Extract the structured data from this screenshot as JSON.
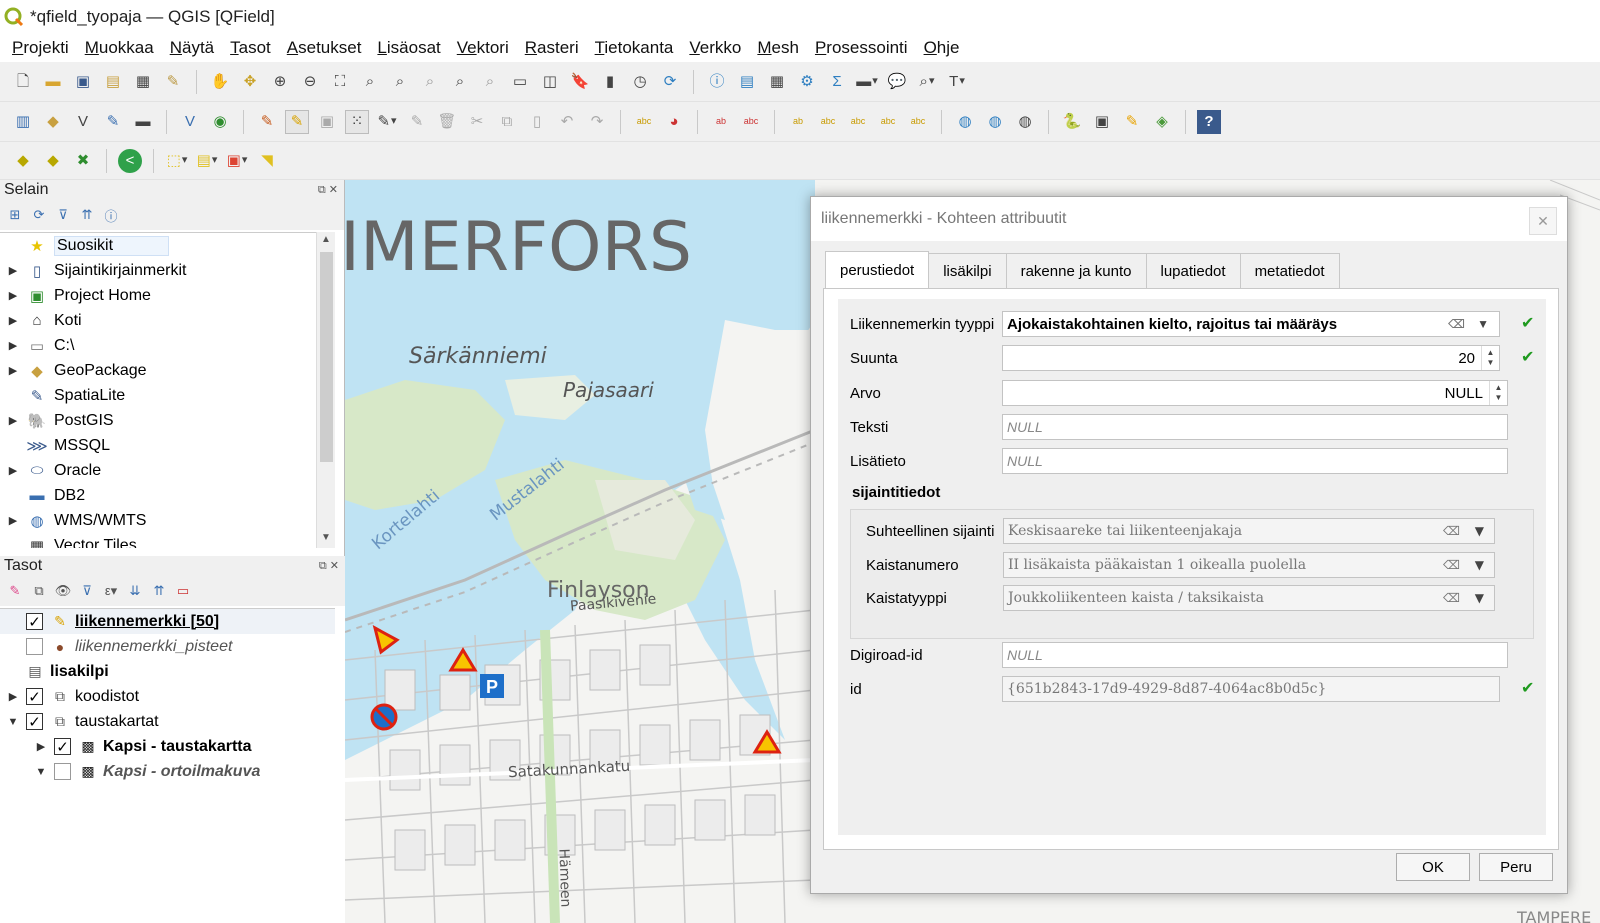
{
  "window": {
    "title": "*qfield_tyopaja — QGIS [QField]"
  },
  "menubar": [
    {
      "label": "Projekti",
      "u": "P",
      "rest": "rojekti"
    },
    {
      "label": "Muokkaa",
      "u": "M",
      "rest": "uokkaa"
    },
    {
      "label": "Näytä",
      "u": "N",
      "rest": "äytä"
    },
    {
      "label": "Tasot",
      "u": "T",
      "rest": "asot"
    },
    {
      "label": "Asetukset",
      "u": "A",
      "rest": "setukset"
    },
    {
      "label": "Lisäosat",
      "u": "L",
      "rest": "isäosat"
    },
    {
      "label": "Vektori",
      "u": "Ve",
      "rest": "ktori"
    },
    {
      "label": "Rasteri",
      "u": "R",
      "rest": "asteri"
    },
    {
      "label": "Tietokanta",
      "u": "T",
      "rest": "ietokanta"
    },
    {
      "label": "Verkko",
      "u": "V",
      "rest": "erkko"
    },
    {
      "label": "Mesh",
      "u": "M",
      "rest": "esh"
    },
    {
      "label": "Prosessointi",
      "u": "P",
      "rest": "rosessointi"
    },
    {
      "label": "Ohje",
      "u": "O",
      "rest": "hje"
    }
  ],
  "browser_panel": {
    "title": "Selain",
    "items": [
      {
        "label": "Suosikit",
        "icon": "star-icon",
        "expandable": false,
        "selected": true
      },
      {
        "label": "Sijaintikirjainmerkit",
        "icon": "bookmark-icon",
        "expandable": true
      },
      {
        "label": "Project Home",
        "icon": "project-home-icon",
        "expandable": true
      },
      {
        "label": "Koti",
        "icon": "home-icon",
        "expandable": true
      },
      {
        "label": "C:\\",
        "icon": "folder-icon",
        "expandable": true
      },
      {
        "label": "GeoPackage",
        "icon": "geopackage-icon",
        "expandable": true
      },
      {
        "label": "SpatiaLite",
        "icon": "spatialite-icon",
        "expandable": false
      },
      {
        "label": "PostGIS",
        "icon": "postgis-icon",
        "expandable": true
      },
      {
        "label": "MSSQL",
        "icon": "mssql-icon",
        "expandable": false
      },
      {
        "label": "Oracle",
        "icon": "oracle-icon",
        "expandable": true
      },
      {
        "label": "DB2",
        "icon": "db2-icon",
        "expandable": false
      },
      {
        "label": "WMS/WMTS",
        "icon": "wms-globe-icon",
        "expandable": true
      },
      {
        "label": "Vector Tiles",
        "icon": "vector-tiles-icon",
        "expandable": false
      }
    ]
  },
  "layers_panel": {
    "title": "Tasot",
    "layers": [
      {
        "label": "liikennemerkki [50]",
        "checked": true,
        "style": "bold-underline",
        "icon": "edit-pencil-icon",
        "indent": 0,
        "expander": "",
        "active": true
      },
      {
        "label": "liikennemerkki_pisteet",
        "checked": false,
        "style": "italic",
        "icon": "point-symbol-icon",
        "indent": 0,
        "expander": ""
      },
      {
        "label": "lisakilpi",
        "checked": null,
        "style": "bold",
        "icon": "table-icon",
        "indent": 0,
        "expander": ""
      },
      {
        "label": "koodistot",
        "checked": true,
        "style": "normal",
        "icon": "group-icon",
        "indent": 0,
        "expander": "▶"
      },
      {
        "label": "taustakartat",
        "checked": true,
        "style": "normal",
        "icon": "group-icon",
        "indent": 0,
        "expander": "▼"
      },
      {
        "label": "Kapsi - taustakartta",
        "checked": true,
        "style": "bold",
        "icon": "raster-icon",
        "indent": 1,
        "expander": "▶"
      },
      {
        "label": "Kapsi - ortoilmakuva",
        "checked": false,
        "style": "italic-bold",
        "icon": "raster-icon",
        "indent": 1,
        "expander": "▼"
      }
    ]
  },
  "map": {
    "labels": [
      "IMERFORS",
      "Särkänniemi",
      "Pajasaari",
      "Mustalahti",
      "Kortelahti",
      "Finlayson",
      "Paasikivenie",
      "Satakunnankatu",
      "Hämeen",
      "TAMPERE"
    ],
    "water_color": "#bfe3f3",
    "park_color": "#d7e8c8"
  },
  "dialog": {
    "title": "liikennemerkki - Kohteen attribuutit",
    "tabs": [
      "perustiedot",
      "lisäkilpi",
      "rakenne ja kunto",
      "lupatiedot",
      "metatiedot"
    ],
    "active_tab": "perustiedot",
    "fields": {
      "tyyppi": {
        "label": "Liikennemerkin tyyppi",
        "value": "Ajokaistakohtainen kielto, rajoitus tai määräys"
      },
      "suunta": {
        "label": "Suunta",
        "value": "20"
      },
      "arvo": {
        "label": "Arvo",
        "value": "NULL"
      },
      "teksti": {
        "label": "Teksti",
        "value": "NULL"
      },
      "lisatieto": {
        "label": "Lisätieto",
        "value": "NULL"
      },
      "suht_sijainti": {
        "label": "Suhteellinen sijainti",
        "value": "Keskisaareke tai liikenteenjakaja"
      },
      "kaistanumero": {
        "label": "Kaistanumero",
        "value": "II lisäkaista pääkaistan 1 oikealla puolella"
      },
      "kaistatyyppi": {
        "label": "Kaistatyyppi",
        "value": "Joukkoliikenteen kaista / taksikaista"
      },
      "digiroad": {
        "label": "Digiroad-id",
        "value": "NULL"
      },
      "id": {
        "label": "id",
        "value": "{651b2843-17d9-4929-8d87-4064ac8b0d5c}"
      }
    },
    "group_title": "sijaintitiedot",
    "buttons": {
      "ok": "OK",
      "cancel": "Peru"
    }
  },
  "colors": {
    "accent_check": "#1f9a1f",
    "qgis_green": "#93b023"
  }
}
